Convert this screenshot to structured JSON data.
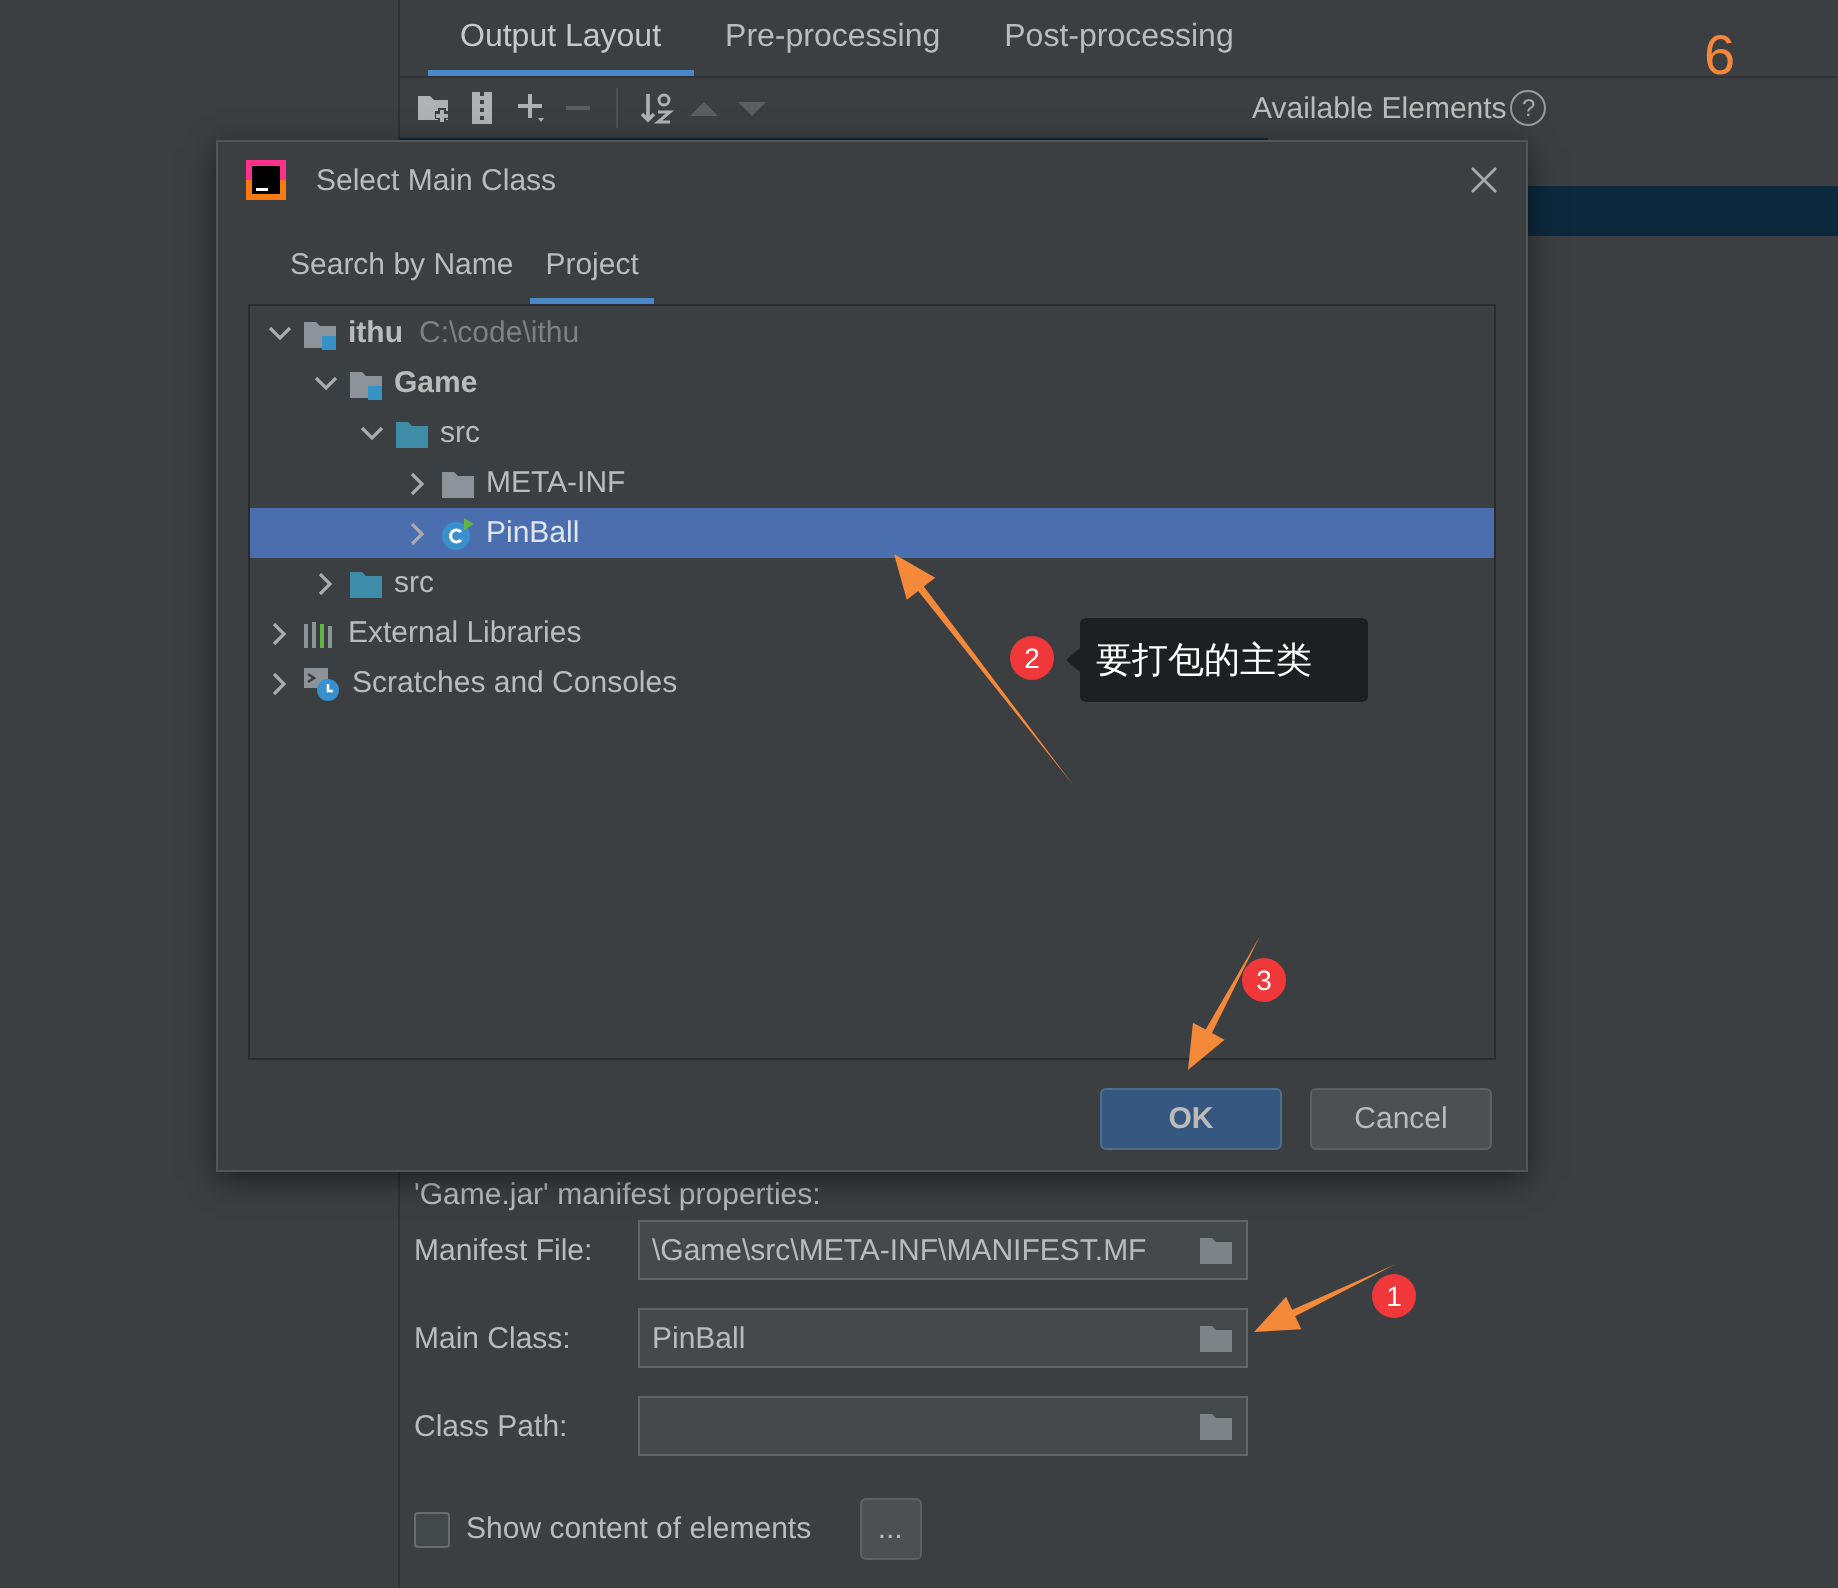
{
  "settings": {
    "tabs": [
      {
        "label": "Output Layout",
        "selected": true
      },
      {
        "label": "Pre-processing",
        "selected": false
      },
      {
        "label": "Post-processing",
        "selected": false
      }
    ],
    "toolbar": [
      {
        "kind": "add-folder",
        "disabled": false
      },
      {
        "kind": "archive",
        "disabled": false
      },
      {
        "kind": "add",
        "disabled": false
      },
      {
        "kind": "remove",
        "disabled": true
      },
      {
        "kind": "sort",
        "disabled": false
      },
      {
        "kind": "up",
        "disabled": true
      },
      {
        "kind": "down",
        "disabled": true
      }
    ],
    "available_elements": {
      "label": "Available Elements",
      "help": "?"
    },
    "manifest_heading": "'Game.jar' manifest properties:",
    "fields": [
      {
        "label": "Manifest File:",
        "value": "\\Game\\src\\META-INF\\MANIFEST.MF"
      },
      {
        "label": "Main Class:",
        "value": "PinBall"
      },
      {
        "label": "Class Path:"
      }
    ],
    "show_content": {
      "label": "Show content of elements",
      "checked": false,
      "button": "..."
    }
  },
  "dialog": {
    "title": "Select Main Class",
    "tabs": [
      {
        "label": "Search by Name",
        "selected": false
      },
      {
        "label": "Project",
        "selected": true
      }
    ],
    "tree": [
      {
        "label": "ithu",
        "kind": "module",
        "path": "C:\\code\\ithu",
        "expanded": true,
        "selected": false,
        "children": [
          {
            "label": "Game",
            "kind": "module",
            "expanded": true,
            "selected": false,
            "children": [
              {
                "label": "src",
                "kind": "source-folder",
                "expanded": true,
                "selected": false,
                "children": [
                  {
                    "label": "META-INF",
                    "kind": "folder",
                    "expanded": false,
                    "selected": false
                  },
                  {
                    "label": "PinBall",
                    "kind": "class",
                    "expanded": false,
                    "selected": true
                  }
                ]
              }
            ]
          },
          {
            "label": "src",
            "kind": "source-folder",
            "expanded": false,
            "selected": false
          }
        ]
      },
      {
        "label": "External Libraries",
        "kind": "libraries",
        "expanded": false,
        "selected": false
      },
      {
        "label": "Scratches and Consoles",
        "kind": "scratches",
        "expanded": false,
        "selected": false
      }
    ],
    "buttons": [
      {
        "label": "OK",
        "kind": "default"
      },
      {
        "label": "Cancel",
        "kind": "normal"
      }
    ]
  },
  "annotations": {
    "page_number": "6",
    "badges": [
      "1",
      "2",
      "3"
    ],
    "callout": "要打包的主类"
  }
}
